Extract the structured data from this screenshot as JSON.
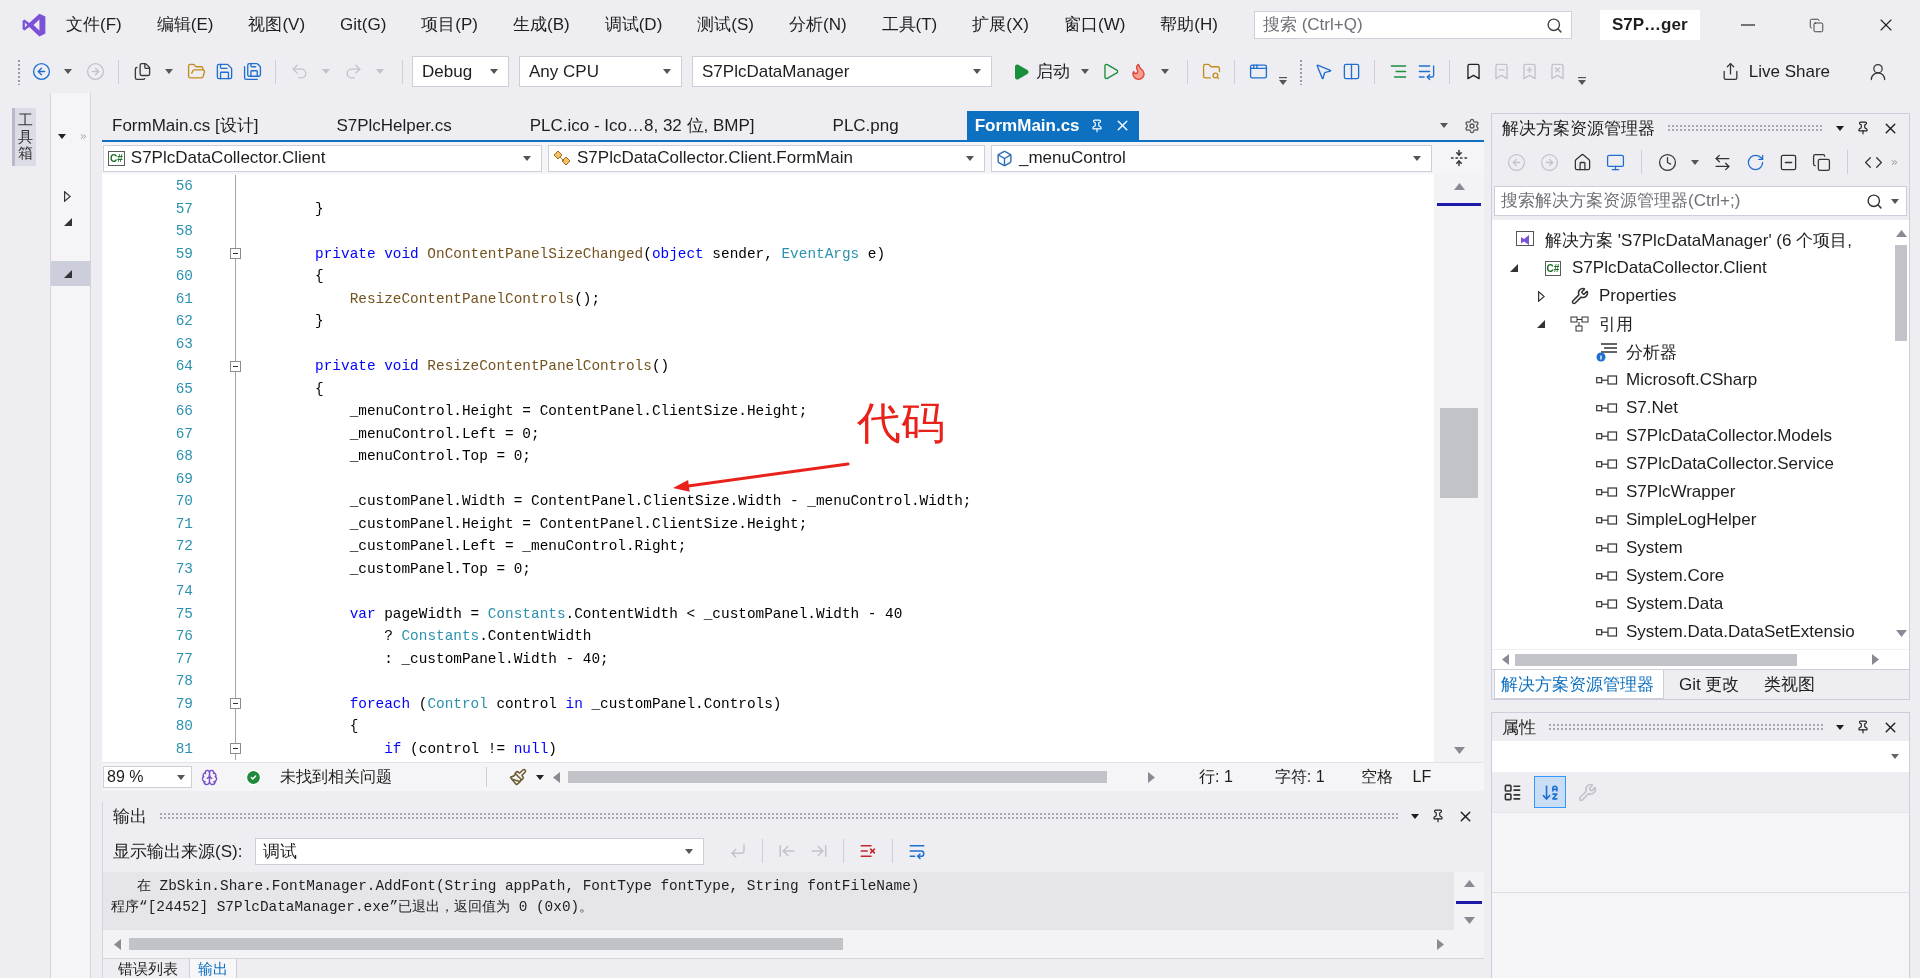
{
  "menu_bar": {
    "items": [
      "文件(F)",
      "编辑(E)",
      "视图(V)",
      "Git(G)",
      "项目(P)",
      "生成(B)",
      "调试(D)",
      "测试(S)",
      "分析(N)",
      "工具(T)",
      "扩展(X)",
      "窗口(W)",
      "帮助(H)"
    ],
    "search": {
      "placeholder": "搜索 (Ctrl+Q)"
    },
    "solution_name": "S7P…ger"
  },
  "toolbar": {
    "buttons": [
      {
        "disabled": false
      },
      {
        "disabled": true
      },
      {
        "disabled": false
      },
      {
        "disabled": false
      },
      {
        "disabled": false
      },
      {
        "disabled": false
      },
      {
        "disabled": true
      },
      {
        "disabled": true
      },
      {
        "disabled": false
      },
      {
        "disabled": false
      },
      {
        "disabled": false
      },
      {
        "disabled": false
      },
      {
        "disabled": false
      },
      {
        "disabled": false
      },
      {
        "disabled": false
      },
      {
        "disabled": false
      },
      {
        "disabled": false
      },
      {
        "disabled": true
      },
      {
        "disabled": true
      },
      {
        "disabled": true
      }
    ],
    "configuration": "Debug",
    "platform": "Any CPU",
    "startup_project": "S7PlcDataManager",
    "start_label": "启动",
    "live_share_label": "Live Share"
  },
  "toolbox": {
    "label": "工具箱"
  },
  "outline_panel": {
    "rows": [
      {
        "expanded": false,
        "selected": false
      },
      {
        "expanded": true,
        "selected": false
      },
      {
        "expanded": true,
        "selected": true
      }
    ]
  },
  "editor": {
    "tabs": [
      {
        "label": "FormMain.cs [设计]",
        "selected": false
      },
      {
        "label": "S7PlcHelper.cs",
        "selected": false
      },
      {
        "label": "PLC.ico - Ico…8, 32 位, BMP]",
        "selected": false
      },
      {
        "label": "PLC.png",
        "selected": false
      },
      {
        "label": "FormMain.cs",
        "selected": true
      }
    ],
    "navigation": [
      {
        "badge": "C#",
        "text": "S7PlcDataCollector.Client"
      },
      {
        "text": "S7PlcDataCollector.Client.FormMain"
      },
      {
        "text": "_menuControl"
      }
    ],
    "lines": [
      {
        "number": "56",
        "foldable": false
      },
      {
        "number": "57",
        "segments": [
          {
            "text": "        }",
            "kind": "plain"
          }
        ],
        "foldable": false
      },
      {
        "number": "58",
        "foldable": false
      },
      {
        "number": "59",
        "segments": [
          {
            "text": "        private void ",
            "kind": "keyword"
          },
          {
            "text": "OnContentPanelSizeChanged",
            "kind": "method"
          },
          {
            "text": "(",
            "kind": "plain"
          },
          {
            "text": "object",
            "kind": "keyword"
          },
          {
            "text": " sender, ",
            "kind": "plain"
          },
          {
            "text": "EventArgs",
            "kind": "type"
          },
          {
            "text": " e)",
            "kind": "plain"
          }
        ],
        "foldable": true
      },
      {
        "number": "60",
        "segments": [
          {
            "text": "        {",
            "kind": "plain"
          }
        ],
        "foldable": false
      },
      {
        "number": "61",
        "segments": [
          {
            "text": "            ResizeContentPanelControls",
            "kind": "method"
          },
          {
            "text": "();",
            "kind": "plain"
          }
        ],
        "foldable": false
      },
      {
        "number": "62",
        "segments": [
          {
            "text": "        }",
            "kind": "plain"
          }
        ],
        "foldable": false
      },
      {
        "number": "63",
        "foldable": false
      },
      {
        "number": "64",
        "segments": [
          {
            "text": "        private void ",
            "kind": "keyword"
          },
          {
            "text": "ResizeContentPanelControls",
            "kind": "method"
          },
          {
            "text": "()",
            "kind": "plain"
          }
        ],
        "foldable": true
      },
      {
        "number": "65",
        "segments": [
          {
            "text": "        {",
            "kind": "plain"
          }
        ],
        "foldable": false
      },
      {
        "number": "66",
        "segments": [
          {
            "text": "            _menuControl.Height = ContentPanel.ClientSize.Height;",
            "kind": "plain"
          }
        ],
        "foldable": false
      },
      {
        "number": "67",
        "segments": [
          {
            "text": "            _menuControl.Left = 0;",
            "kind": "plain"
          }
        ],
        "foldable": false
      },
      {
        "number": "68",
        "segments": [
          {
            "text": "            _menuControl.Top = 0;",
            "kind": "plain"
          }
        ],
        "foldable": false
      },
      {
        "number": "69",
        "foldable": false
      },
      {
        "number": "70",
        "segments": [
          {
            "text": "            _customPanel.Width = ContentPanel.ClientSize.Width - _menuControl.Width;",
            "kind": "plain"
          }
        ],
        "foldable": false
      },
      {
        "number": "71",
        "segments": [
          {
            "text": "            _customPanel.Height = ContentPanel.ClientSize.Height;",
            "kind": "plain"
          }
        ],
        "foldable": false
      },
      {
        "number": "72",
        "segments": [
          {
            "text": "            _customPanel.Left = _menuControl.Right;",
            "kind": "plain"
          }
        ],
        "foldable": false
      },
      {
        "number": "73",
        "segments": [
          {
            "text": "            _customPanel.Top = 0;",
            "kind": "plain"
          }
        ],
        "foldable": false
      },
      {
        "number": "74",
        "foldable": false
      },
      {
        "number": "75",
        "segments": [
          {
            "text": "            var",
            "kind": "keyword"
          },
          {
            "text": " pageWidth = ",
            "kind": "plain"
          },
          {
            "text": "Constants",
            "kind": "type"
          },
          {
            "text": ".ContentWidth < _customPanel.Width - 40",
            "kind": "plain"
          }
        ],
        "foldable": false
      },
      {
        "number": "76",
        "segments": [
          {
            "text": "                ? ",
            "kind": "plain"
          },
          {
            "text": "Constants",
            "kind": "type"
          },
          {
            "text": ".ContentWidth",
            "kind": "plain"
          }
        ],
        "foldable": false
      },
      {
        "number": "77",
        "segments": [
          {
            "text": "                : _customPanel.Width - 40;",
            "kind": "plain"
          }
        ],
        "foldable": false
      },
      {
        "number": "78",
        "foldable": false
      },
      {
        "number": "79",
        "segments": [
          {
            "text": "            foreach",
            "kind": "keyword"
          },
          {
            "text": " (",
            "kind": "plain"
          },
          {
            "text": "Control",
            "kind": "type"
          },
          {
            "text": " control ",
            "kind": "plain"
          },
          {
            "text": "in",
            "kind": "keyword"
          },
          {
            "text": " _customPanel.Controls)",
            "kind": "plain"
          }
        ],
        "foldable": true
      },
      {
        "number": "80",
        "segments": [
          {
            "text": "            {",
            "kind": "plain"
          }
        ],
        "foldable": false
      },
      {
        "number": "81",
        "segments": [
          {
            "text": "                if",
            "kind": "keyword"
          },
          {
            "text": " (control != ",
            "kind": "plain"
          },
          {
            "text": "null",
            "kind": "keyword"
          },
          {
            "text": ")",
            "kind": "plain"
          }
        ],
        "foldable": true
      }
    ],
    "status": {
      "zoom": "89 %",
      "issues": "未找到相关问题",
      "line": "行: 1",
      "column": "字符: 1",
      "indent": "空格",
      "line_ending": "LF"
    }
  },
  "annotation": {
    "text": "代码"
  },
  "output": {
    "title": "输出",
    "source_label": "显示输出来源(S):",
    "source": "调试",
    "toolbar_buttons": [
      {
        "disabled": true
      },
      {
        "disabled": true
      },
      {
        "disabled": true
      },
      {
        "disabled": false
      },
      {
        "disabled": false
      }
    ],
    "lines": [
      "   在 ZbSkin.Share.FontManager.AddFont(String appPath, FontType fontType, String fontFileName)",
      "程序“[24452] S7PlcDataManager.exe”已退出，返回值为 0 (0x0)。"
    ],
    "tabs": [
      {
        "label": "错误列表",
        "selected": false
      },
      {
        "label": "输出",
        "selected": true
      }
    ]
  },
  "solution_explorer": {
    "title": "解决方案资源管理器",
    "toolbar_buttons": [
      {
        "disabled": true
      },
      {
        "disabled": true
      },
      {
        "disabled": false
      },
      {
        "disabled": false
      },
      {
        "disabled": false
      },
      {
        "disabled": false
      },
      {
        "disabled": false
      },
      {
        "disabled": false
      },
      {
        "disabled": false
      },
      {
        "disabled": false
      }
    ],
    "search": {
      "placeholder": "搜索解决方案资源管理器(Ctrl+;)"
    },
    "tree": [
      {
        "label": "解决方案 'S7PlcDataManager' (6 个项目,",
        "kind": "solution",
        "children": [
          {
            "label": "S7PlcDataCollector.Client",
            "kind": "project",
            "badge": "C#",
            "expanded": true,
            "children": [
              {
                "label": "Properties",
                "kind": "properties",
                "expanded": false
              },
              {
                "label": "引用",
                "kind": "references",
                "expanded": true,
                "children": [
                  {
                    "label": "分析器",
                    "kind": "analyzer"
                  },
                  {
                    "label": "Microsoft.CSharp",
                    "kind": "assembly"
                  },
                  {
                    "label": "S7.Net",
                    "kind": "assembly"
                  },
                  {
                    "label": "S7PlcDataCollector.Models",
                    "kind": "assembly"
                  },
                  {
                    "label": "S7PlcDataCollector.Service",
                    "kind": "assembly"
                  },
                  {
                    "label": "S7PlcWrapper",
                    "kind": "assembly"
                  },
                  {
                    "label": "SimpleLogHelper",
                    "kind": "assembly"
                  },
                  {
                    "label": "System",
                    "kind": "assembly"
                  },
                  {
                    "label": "System.Core",
                    "kind": "assembly"
                  },
                  {
                    "label": "System.Data",
                    "kind": "assembly"
                  },
                  {
                    "label": "System.Data.DataSetExtensio",
                    "kind": "assembly"
                  }
                ]
              }
            ]
          }
        ]
      }
    ],
    "tabs": [
      {
        "label": "解决方案资源管理器",
        "selected": true
      },
      {
        "label": "Git 更改",
        "selected": false
      },
      {
        "label": "类视图",
        "selected": false
      }
    ]
  },
  "properties": {
    "title": "属性",
    "sort_buttons": [
      {
        "selected": false
      },
      {
        "selected": true
      }
    ],
    "pages_button": {
      "disabled": true
    }
  }
}
